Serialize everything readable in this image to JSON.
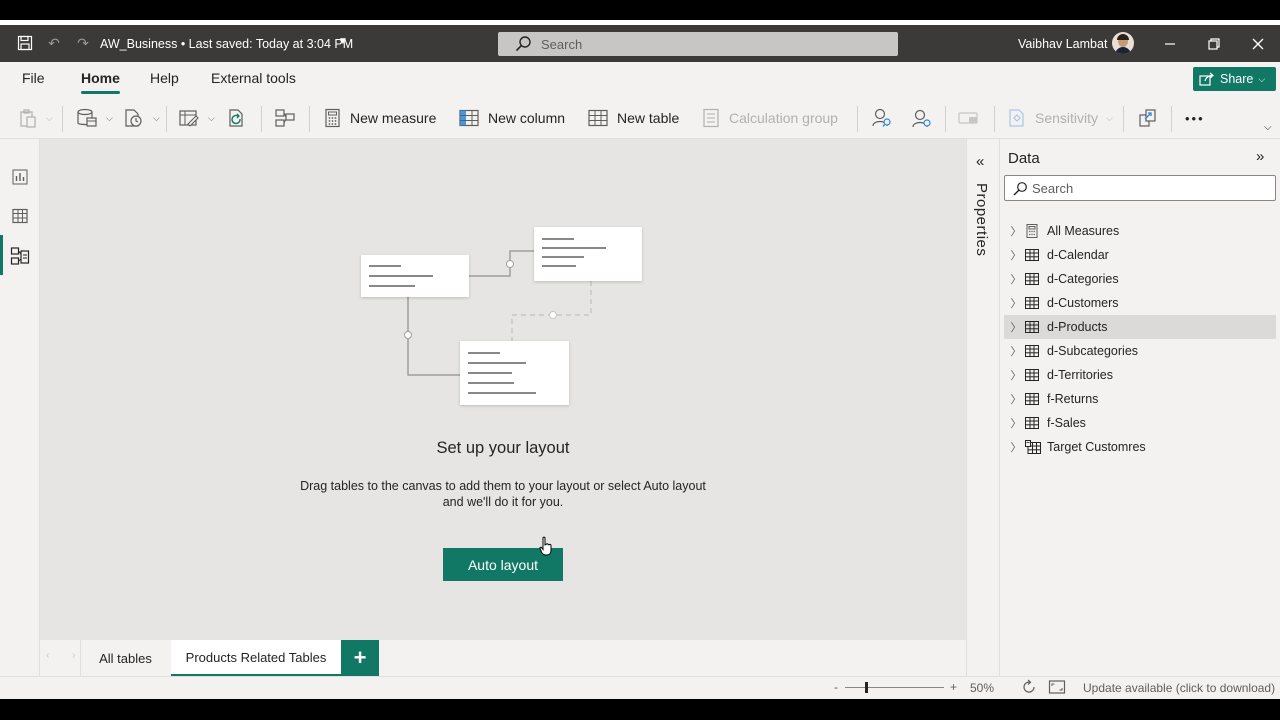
{
  "titlebar": {
    "title": "AW_Business • Last saved: Today at 3:04 PM",
    "search_placeholder": "Search",
    "user_name": "Vaibhav Lambat"
  },
  "ribbon_tabs": [
    "File",
    "Home",
    "Help",
    "External tools"
  ],
  "active_tab": "Home",
  "share_label": "Share",
  "ribbon": {
    "new_measure": "New measure",
    "new_column": "New column",
    "new_table": "New table",
    "calculation_group": "Calculation group",
    "sensitivity": "Sensitivity",
    "more": "•••"
  },
  "canvas": {
    "setup_title": "Set up your layout",
    "setup_description": "Drag tables to the canvas to add them to your layout or select Auto layout and we'll do it for you.",
    "auto_layout_label": "Auto layout"
  },
  "bottom_tabs": {
    "all_tables": "All tables",
    "products_related": "Products Related Tables",
    "add": "+"
  },
  "properties_label": "Properties",
  "data_pane": {
    "title": "Data",
    "search_placeholder": "Search",
    "tables": [
      {
        "name": "All Measures",
        "icon": "measure-table-icon"
      },
      {
        "name": "d-Calendar",
        "icon": "table-icon"
      },
      {
        "name": "d-Categories",
        "icon": "table-icon"
      },
      {
        "name": "d-Customers",
        "icon": "table-icon"
      },
      {
        "name": "d-Products",
        "icon": "table-icon",
        "selected": true
      },
      {
        "name": "d-Subcategories",
        "icon": "table-icon"
      },
      {
        "name": "d-Territories",
        "icon": "table-icon"
      },
      {
        "name": "f-Returns",
        "icon": "table-icon"
      },
      {
        "name": "f-Sales",
        "icon": "table-icon"
      },
      {
        "name": "Target Customres",
        "icon": "calculated-table-icon"
      }
    ]
  },
  "statusbar": {
    "zoom_minus": "-",
    "zoom_plus": "+",
    "zoom_level": "50%",
    "update_text": "Update available (click to download)"
  },
  "colors": {
    "accent": "#117865",
    "titlebar": "#3b3a39",
    "canvas": "#e6e5e3"
  }
}
